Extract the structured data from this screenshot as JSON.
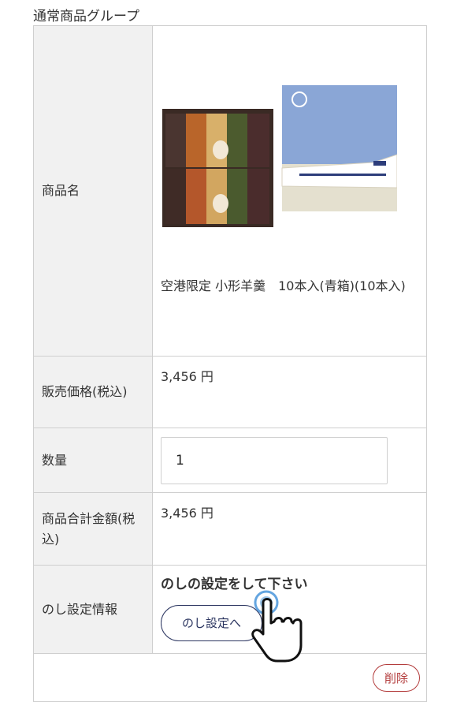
{
  "group_title": "通常商品グループ",
  "rows": {
    "product_name": {
      "label": "商品名",
      "value": "空港限定 小形羊羹　10本入(青箱)(10本入)"
    },
    "price": {
      "label": "販売価格(税込)",
      "value": "3,456 円"
    },
    "quantity": {
      "label": "数量",
      "value": "1"
    },
    "total": {
      "label": "商品合計金額(税込)",
      "value": "3,456 円"
    },
    "noshi": {
      "label": "のし設定情報",
      "message": "のしの設定をして下さい",
      "button_label": "のし設定へ"
    }
  },
  "delete_label": "削除",
  "colors": {
    "accent": "#2b3560",
    "delete": "#b33c3c",
    "header_bg": "#f1f1f1",
    "cursor_highlight": "#3d8fd8"
  },
  "icons": {
    "cursor": "hand-pointer-icon"
  }
}
